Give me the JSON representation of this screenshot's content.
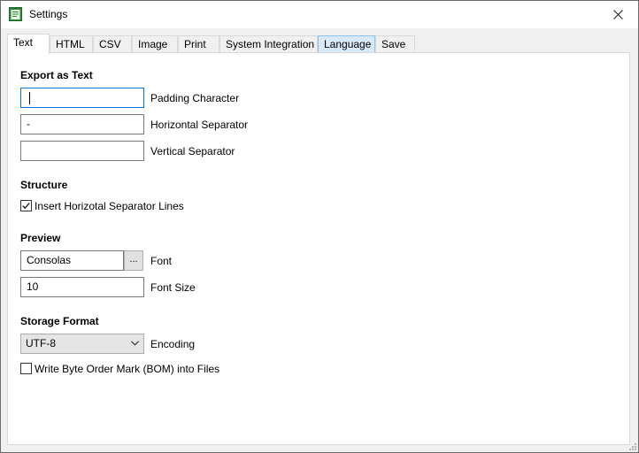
{
  "window": {
    "title": "Settings",
    "app_icon": "notepad-icon",
    "close_icon": "close-icon"
  },
  "tabs": [
    {
      "label": "Text",
      "active": true
    },
    {
      "label": "HTML"
    },
    {
      "label": "CSV"
    },
    {
      "label": "Image"
    },
    {
      "label": "Print"
    },
    {
      "label": "System Integration"
    },
    {
      "label": "Language",
      "hovered": true
    },
    {
      "label": "Save"
    }
  ],
  "export_text": {
    "heading": "Export as Text",
    "padding_char": {
      "value": "",
      "label": "Padding Character"
    },
    "horizontal_sep": {
      "value": "-",
      "label": "Horizontal Separator"
    },
    "vertical_sep": {
      "value": "",
      "label": "Vertical Separator"
    }
  },
  "structure": {
    "heading": "Structure",
    "insert_lines": {
      "label": "Insert Horizotal Separator Lines",
      "checked": true
    }
  },
  "preview": {
    "heading": "Preview",
    "font": {
      "value": "Consolas",
      "browse_label": "...",
      "label": "Font"
    },
    "font_size": {
      "value": "10",
      "label": "Font Size"
    }
  },
  "storage": {
    "heading": "Storage Format",
    "encoding": {
      "value": "UTF-8",
      "label": "Encoding"
    },
    "bom": {
      "label": "Write Byte Order Mark (BOM) into Files",
      "checked": false
    }
  }
}
